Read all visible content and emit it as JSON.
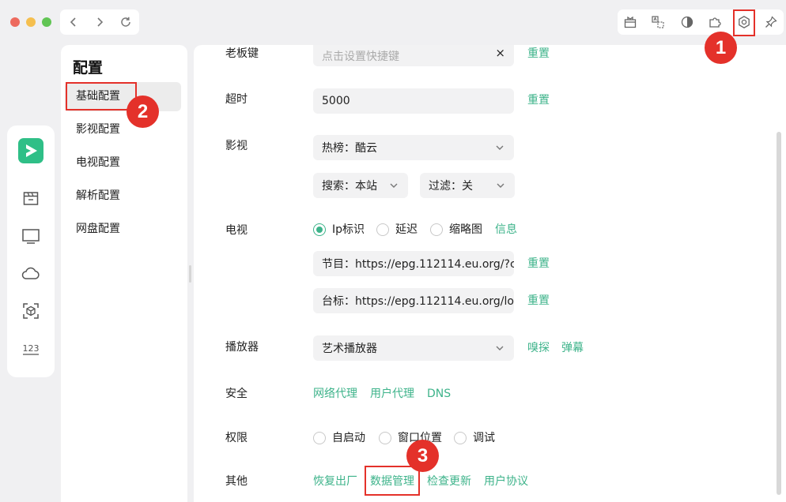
{
  "window": {
    "traffic_lights": {
      "close": "#ed6a5e",
      "minimize": "#f5bf4f",
      "zoom": "#61c554"
    },
    "nav": {
      "back_icon": "chevron-left-icon",
      "forward_icon": "chevron-right-icon",
      "reload_icon": "reload-icon"
    },
    "toolbar": [
      "gift-icon",
      "translate-icon",
      "contrast-icon",
      "puzzle-icon",
      "settings-icon",
      "pin-icon"
    ]
  },
  "rail": {
    "logo_color": "#2fbf87",
    "items": [
      "logo-icon",
      "movie-icon",
      "tv-icon",
      "cloud-icon",
      "scan-icon",
      "numbers-icon"
    ]
  },
  "sidebar": {
    "title": "配置",
    "items": [
      {
        "label": "基础配置",
        "active": true
      },
      {
        "label": "影视配置"
      },
      {
        "label": "电视配置"
      },
      {
        "label": "解析配置"
      },
      {
        "label": "网盘配置"
      }
    ]
  },
  "settings": {
    "accent": "#3db38a",
    "hotkey": {
      "label": "老板键",
      "placeholder": "点击设置快捷键",
      "clear": "×",
      "reset": "重置"
    },
    "timeout": {
      "label": "超时",
      "value": "5000",
      "reset": "重置"
    },
    "film": {
      "label": "影视",
      "source": "热榜：酷云",
      "search": "搜索：本站",
      "filter": "过滤：关"
    },
    "tv": {
      "label": "电视",
      "options": [
        "Ip标识",
        "延迟",
        "缩略图"
      ],
      "selected": 0,
      "info": "信息",
      "epg": "节目：https://epg.112114.eu.org/?c...",
      "logo": "台标：https://epg.112114.eu.org/lo...",
      "reset": "重置"
    },
    "player": {
      "label": "播放器",
      "value": "艺术播放器",
      "sniff": "嗅探",
      "danmaku": "弹幕"
    },
    "security": {
      "label": "安全",
      "links": [
        "网络代理",
        "用户代理",
        "DNS"
      ]
    },
    "permission": {
      "label": "权限",
      "options": [
        "自启动",
        "窗口位置",
        "调试"
      ]
    },
    "other": {
      "label": "其他",
      "links": [
        "恢复出厂",
        "数据管理",
        "检查更新",
        "用户协议"
      ]
    }
  },
  "annotations": {
    "color": "#e4312a",
    "steps": [
      "1",
      "2",
      "3"
    ]
  }
}
